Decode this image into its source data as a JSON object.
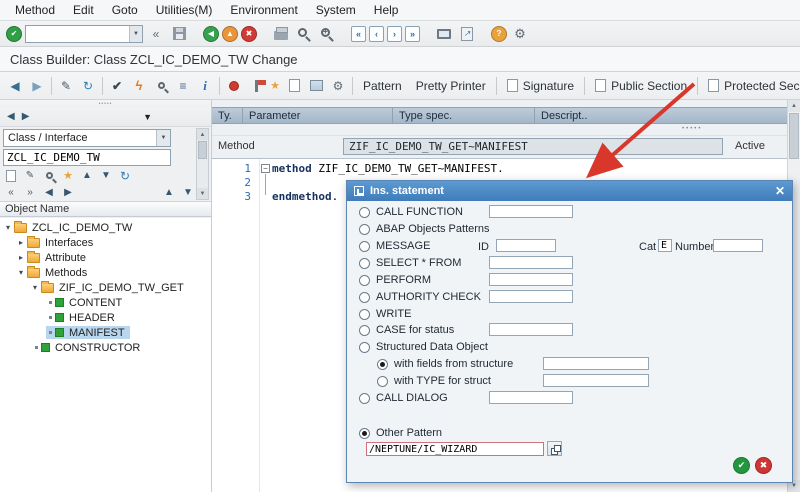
{
  "menubar": {
    "items": [
      "Method",
      "Edit",
      "Goto",
      "Utilities(M)",
      "Environment",
      "System",
      "Help"
    ]
  },
  "titlebar": {
    "text": "Class Builder: Class ZCL_IC_DEMO_TW Change"
  },
  "app_toolbar": {
    "pattern": "Pattern",
    "pretty_printer": "Pretty Printer",
    "signature": "Signature",
    "public_section": "Public Section",
    "protected_section": "Protected Sec"
  },
  "sidebar": {
    "selector_value": "Class / Interface",
    "object_value": "ZCL_IC_DEMO_TW",
    "header": "Object Name",
    "tree": [
      {
        "label": "ZCL_IC_DEMO_TW"
      },
      {
        "label": "Interfaces"
      },
      {
        "label": "Attribute"
      },
      {
        "label": "Methods"
      },
      {
        "label": "ZIF_IC_DEMO_TW_GET"
      },
      {
        "label": "CONTENT"
      },
      {
        "label": "HEADER"
      },
      {
        "label": "MANIFEST"
      },
      {
        "label": "CONSTRUCTOR"
      }
    ]
  },
  "params_header": {
    "cols": [
      "Ty.",
      "Parameter",
      "Type spec.",
      "Descript.."
    ]
  },
  "method_bar": {
    "label": "Method",
    "value": "ZIF_IC_DEMO_TW_GET~MANIFEST",
    "status": "Active"
  },
  "editor": {
    "lines": [
      {
        "no": "1",
        "kw": "method",
        "rest": " ZIF_IC_DEMO_TW_GET~MANIFEST."
      },
      {
        "no": "2",
        "kw": "",
        "rest": ""
      },
      {
        "no": "3",
        "kw": "endmethod",
        "rest": "."
      }
    ]
  },
  "dialog": {
    "title": "Ins. statement",
    "options": {
      "call_function": "CALL FUNCTION",
      "abap_patterns": "ABAP Objects Patterns",
      "message": "MESSAGE",
      "id_label": "ID",
      "cat_label": "Cat",
      "cat_value": "E",
      "number_label": "Number",
      "select_from": "SELECT * FROM",
      "perform": "PERFORM",
      "authority_check": "AUTHORITY CHECK",
      "write": "WRITE",
      "case_for_status": "CASE for status",
      "structured_data": "Structured Data Object",
      "with_fields": "with fields from structure",
      "with_type": "with TYPE for struct",
      "call_dialog": "CALL DIALOG",
      "other_pattern": "Other Pattern"
    },
    "other_pattern_value": "/NEPTUNE/IC_WIZARD"
  },
  "colors": {
    "dialog_titlebar": "#4584c4",
    "tree_selection": "#b9d6ef",
    "annotation_arrow": "#d9372b",
    "method_icon_green": "#2fa23a",
    "folder_orange": "#f0a838",
    "confirm_green": "#23963f",
    "cancel_red": "#d13434"
  },
  "icons": {
    "enter": "✔",
    "dropdown": "▼",
    "collapse": "«",
    "expand": "»",
    "back": "◀",
    "exit": "▲",
    "cancel": "✖",
    "page_first": "«",
    "page_prev": "‹",
    "page_next": "›",
    "page_last": "»",
    "help": "?",
    "gear": "⚙",
    "shortcut_arrow": "↗",
    "nav_back": "◀",
    "nav_fwd": "▶",
    "pencil": "✎",
    "refresh": "↻",
    "check": "✔",
    "activate": "ϟ",
    "where_used": "≡",
    "info": "i",
    "star": "★",
    "up": "▲",
    "down": "▼",
    "caret_open": "▾",
    "caret_closed": "▸",
    "grip_dots": "•••••",
    "fold_minus": "−",
    "close": "✕",
    "ok": "✔"
  }
}
